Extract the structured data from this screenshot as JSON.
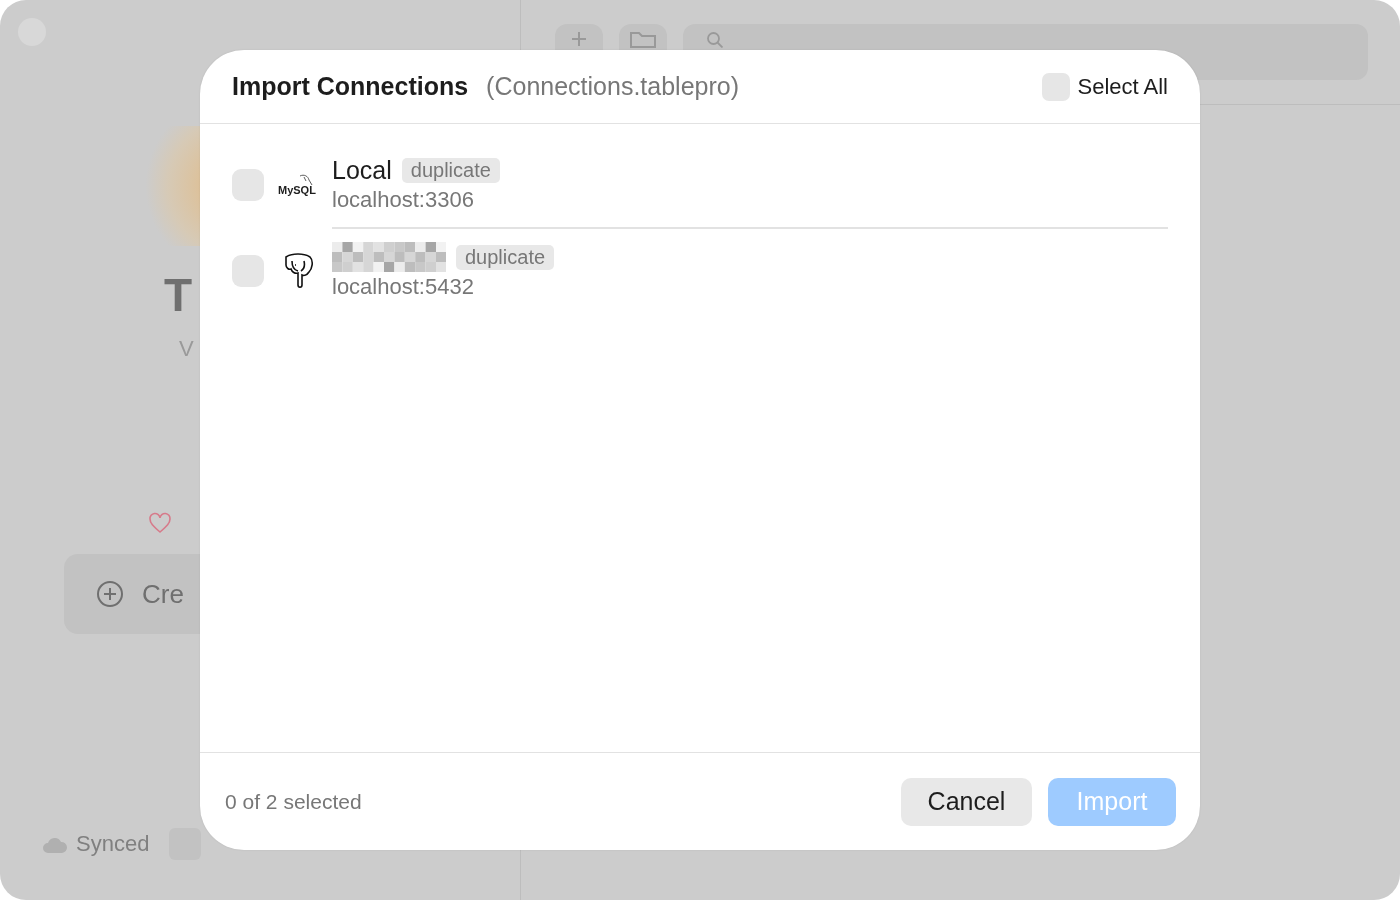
{
  "background": {
    "title_partial": "T",
    "subtitle_partial": "V",
    "create_button_partial": "Cre",
    "status": {
      "label": "Synced"
    }
  },
  "dialog": {
    "title": "Import Connections",
    "file": "(Connections.tablepro)",
    "select_all": {
      "label": "Select All",
      "checked": false
    },
    "connections": [
      {
        "kind": "mysql",
        "logo_text": "MySQL",
        "redacted": false,
        "name": "Local",
        "badge": "duplicate",
        "address": "localhost:3306",
        "checked": false
      },
      {
        "kind": "postgres",
        "redacted": true,
        "badge": "duplicate",
        "address": "localhost:5432",
        "checked": false
      }
    ],
    "footer": {
      "count": "0 of 2 selected"
    },
    "buttons": [
      {
        "kind": "secondary",
        "label": "Cancel",
        "disabled": false
      },
      {
        "kind": "primary",
        "label": "Import",
        "disabled": true
      }
    ]
  }
}
